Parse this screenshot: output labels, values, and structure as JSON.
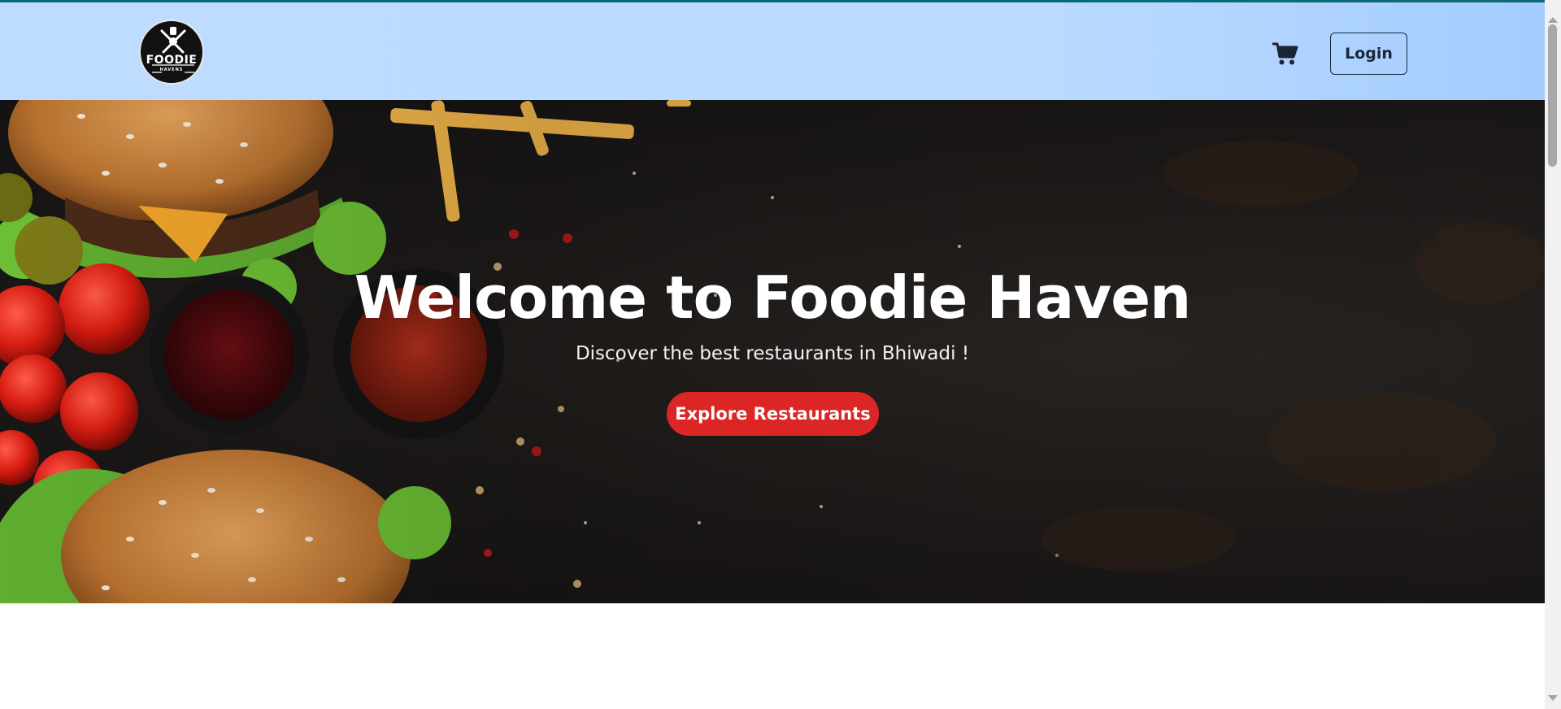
{
  "header": {
    "logo_text": "FOODIE",
    "logo_subtext": "HAVENS",
    "cart_icon": "shopping-cart-icon",
    "login_label": "Login"
  },
  "hero": {
    "title": "Welcome to Foodie Haven",
    "subtitle": "Discover the best restaurants in Bhiwadi !",
    "cta_label": "Explore Restaurants"
  },
  "colors": {
    "header_bg": "#bcdcff",
    "top_strip": "#0b6b74",
    "cta_bg": "#dc2626",
    "text_dark": "#1b2533"
  }
}
